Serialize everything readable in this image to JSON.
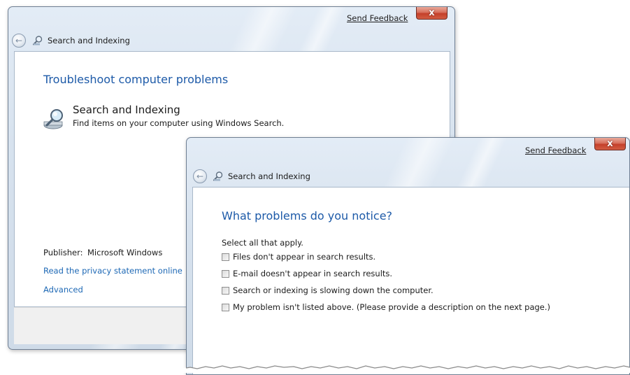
{
  "back_window": {
    "send_feedback": "Send Feedback",
    "close_glyph": "x",
    "nav_title": "Search and Indexing",
    "heading": "Troubleshoot computer problems",
    "item": {
      "title": "Search and Indexing",
      "description": "Find items on your computer using Windows Search.",
      "icon": "search-indexing-icon"
    },
    "publisher_label": "Publisher:",
    "publisher_value": "Microsoft Windows",
    "privacy_link": "Read the privacy statement online",
    "advanced_link": "Advanced"
  },
  "front_window": {
    "send_feedback": "Send Feedback",
    "close_glyph": "x",
    "nav_title": "Search and Indexing",
    "heading": "What problems do you notice?",
    "instructions": "Select all that apply.",
    "options": [
      {
        "label": "Files don't appear in search results.",
        "checked": false
      },
      {
        "label": "E-mail doesn't appear in search results.",
        "checked": false
      },
      {
        "label": "Search or indexing is slowing down the computer.",
        "checked": false
      },
      {
        "label": "My problem isn't listed above. (Please provide a description on the next page.)",
        "checked": false
      }
    ]
  },
  "colors": {
    "heading_blue": "#1d5aa8",
    "link_blue": "#1d68b5",
    "close_red": "#c4402a",
    "chrome": "#d7e2ee"
  }
}
